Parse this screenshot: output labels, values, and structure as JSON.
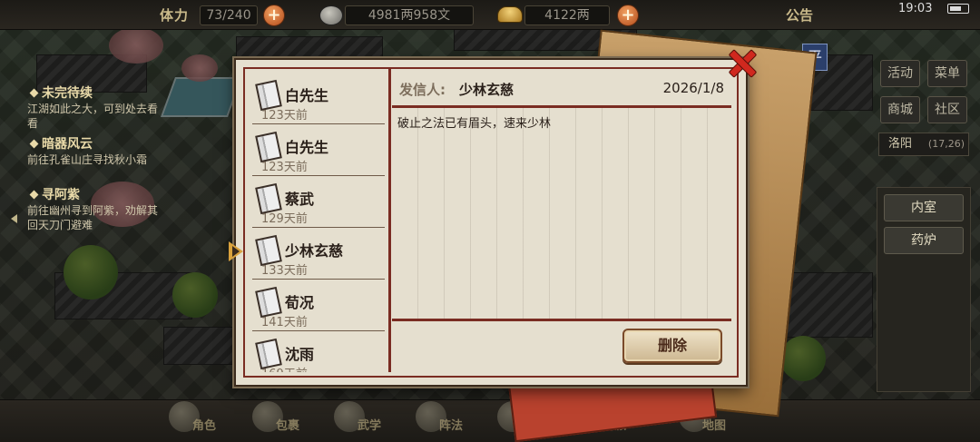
{
  "topbar": {
    "stamina_label": "体力",
    "stamina_value": "73/240",
    "coins_value": "4981两958文",
    "ingots_value": "4122两",
    "notice_label": "公告",
    "time": "19:03"
  },
  "quests": [
    {
      "title": "未完待续",
      "desc": "江湖如此之大，可到处去看看"
    },
    {
      "title": "暗器风云",
      "desc": "前往孔雀山庄寻找秋小霜"
    },
    {
      "title": "寻阿紫",
      "desc": "前往幽州寻到阿紫，劝解其回天刀门避难"
    }
  ],
  "right_panel": {
    "buttons": [
      "活动",
      "菜单",
      "商城",
      "社区"
    ],
    "location": "洛阳",
    "coords": "(17,26)",
    "ping": "平",
    "rooms": [
      "内室",
      "药炉"
    ]
  },
  "mail": {
    "from_label": "发信人:",
    "list": [
      {
        "sender": "白先生",
        "age": "123天前"
      },
      {
        "sender": "白先生",
        "age": "123天前"
      },
      {
        "sender": "蔡武",
        "age": "129天前"
      },
      {
        "sender": "少林玄慈",
        "age": "133天前"
      },
      {
        "sender": "荀况",
        "age": "141天前"
      },
      {
        "sender": "沈雨",
        "age": "169天前"
      }
    ],
    "selected_index": 3,
    "selected": {
      "sender": "少林玄慈",
      "date": "2026/1/8",
      "body": "破止之法已有眉头，速来少林"
    },
    "delete_label": "删除"
  },
  "bottom_nav": [
    "角色",
    "包裹",
    "武学",
    "阵法",
    "伙伴",
    "门派",
    "地图"
  ]
}
